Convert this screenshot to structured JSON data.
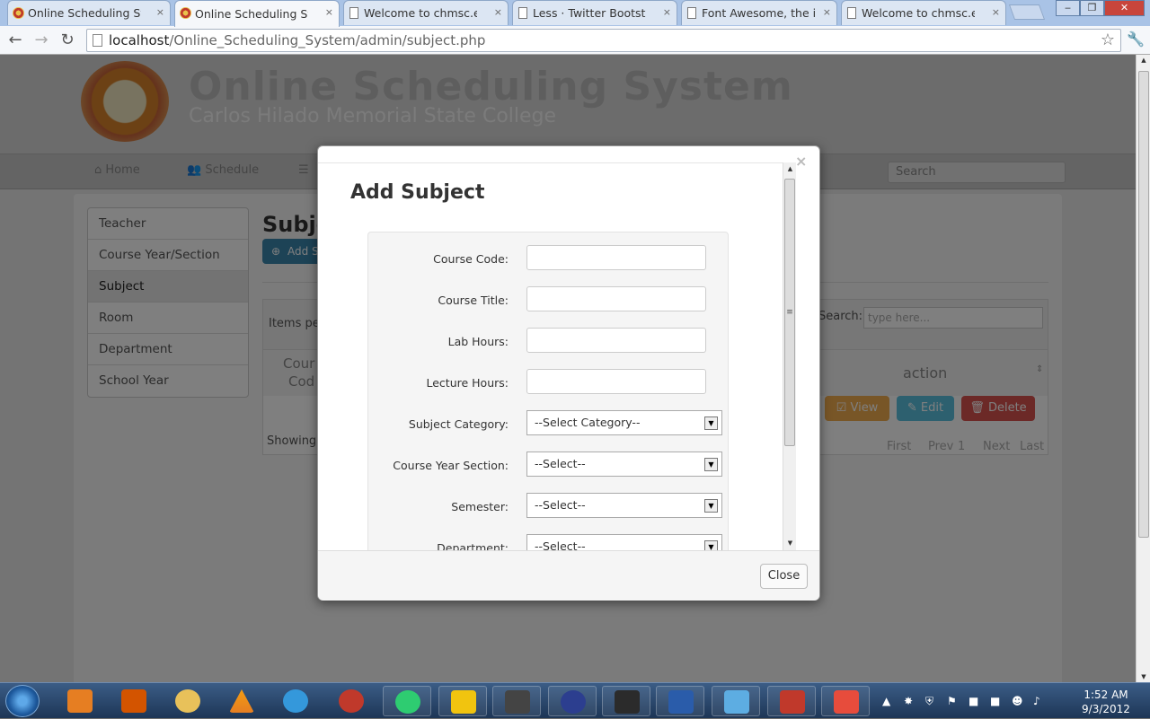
{
  "browser": {
    "tabs": [
      {
        "label": "Online Scheduling System",
        "active": false,
        "icon": "app-favicon"
      },
      {
        "label": "Online Scheduling System",
        "active": true,
        "icon": "app-favicon"
      },
      {
        "label": "Welcome to chmsc.edu.ph",
        "active": false,
        "icon": "page-icon"
      },
      {
        "label": "Less · Twitter Bootstrap",
        "active": false,
        "icon": "page-icon"
      },
      {
        "label": "Font Awesome, the iconic font",
        "active": false,
        "icon": "page-icon"
      },
      {
        "label": "Welcome to chmsc.edu.ph",
        "active": false,
        "icon": "page-icon"
      }
    ],
    "tab_close": "×",
    "url_host": "localhost",
    "url_path": "/Online_Scheduling_System/admin/subject.php"
  },
  "site": {
    "title": "Online Scheduling System",
    "subtitle": "Carlos Hilado Memorial State College",
    "nav": [
      "Home",
      "Schedule"
    ],
    "search_placeholder": "Search"
  },
  "sidebar": {
    "items": [
      {
        "label": "Teacher",
        "active": false
      },
      {
        "label": "Course Year/Section",
        "active": false
      },
      {
        "label": "Subject",
        "active": true
      },
      {
        "label": "Room",
        "active": false
      },
      {
        "label": "Department",
        "active": false
      },
      {
        "label": "School Year",
        "active": false
      }
    ]
  },
  "background": {
    "page_title": "Subje",
    "add_button": "Add S",
    "items_per_page": "Items per",
    "search_label": "Search:",
    "search_placeholder": "type here...",
    "col_course": "Cour",
    "col_code": "Cod",
    "col_action": "action",
    "btn_view": "View",
    "btn_edit": "Edit",
    "btn_delete": "Delete",
    "showing": "Showing",
    "pager": [
      "First",
      "Prev",
      "1",
      "Next",
      "Last"
    ],
    "colors": {
      "view": "#f0ad4e",
      "edit": "#5bc0de",
      "delete": "#d9534f",
      "primary": "#3a87ad"
    }
  },
  "modal": {
    "title": "Add Subject",
    "close_x": "×",
    "fields": [
      {
        "label": "Course Code:",
        "type": "text",
        "value": ""
      },
      {
        "label": "Course Title:",
        "type": "text",
        "value": ""
      },
      {
        "label": "Lab Hours:",
        "type": "text",
        "value": ""
      },
      {
        "label": "Lecture Hours:",
        "type": "text",
        "value": ""
      },
      {
        "label": "Subject Category:",
        "type": "select",
        "value": "--Select Category--"
      },
      {
        "label": "Course Year Section:",
        "type": "select",
        "value": "--Select--"
      },
      {
        "label": "Semester:",
        "type": "select",
        "value": "--Select--"
      },
      {
        "label": "Department:",
        "type": "select",
        "value": "--Select--"
      }
    ],
    "close_button": "Close"
  },
  "taskbar": {
    "time": "1:52 AM",
    "date": "9/3/2012"
  }
}
